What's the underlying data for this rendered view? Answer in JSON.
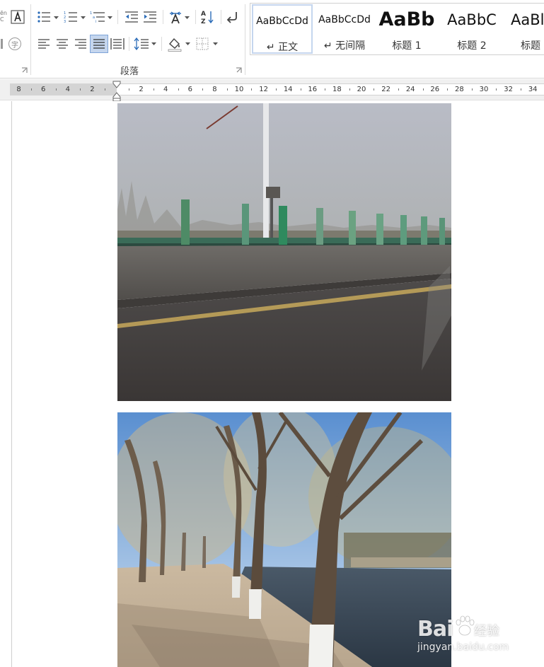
{
  "ribbon": {
    "clipped_font_label_top": "ēn",
    "clipped_font_label_bottom": "C",
    "phonetic_glyph": "字",
    "paragraph_group_label": "段落",
    "colors": {
      "selected_button_bg": "#c5d6ee",
      "selected_button_border": "#7fa4d8",
      "icon_dark": "#444444",
      "icon_blue": "#2b6cb8"
    }
  },
  "styles": {
    "items": [
      {
        "sample": "AaBbCcDd",
        "name": "↵ 正文",
        "selected": true
      },
      {
        "sample": "AaBbCcDd",
        "name": "↵ 无间隔",
        "selected": false
      },
      {
        "sample": "AaBb",
        "name": "标题 1",
        "selected": false
      },
      {
        "sample": "AaBbC",
        "name": "标题 2",
        "selected": false
      },
      {
        "sample": "AaBl",
        "name": "标题",
        "selected": false
      }
    ]
  },
  "ruler": {
    "left_numbers": [
      "8",
      "6",
      "4",
      "2"
    ],
    "right_numbers": [
      "2",
      "4",
      "6",
      "8",
      "10",
      "12",
      "14",
      "16",
      "18",
      "20",
      "22",
      "24",
      "26",
      "28",
      "30",
      "32",
      "34"
    ]
  },
  "document": {
    "images": [
      {
        "description": "highway guardrail"
      },
      {
        "description": "tree-lined canal path"
      }
    ]
  },
  "watermark": {
    "logo": "Bai",
    "logo_suffix": "经验",
    "url": "jingyan.baidu.com"
  }
}
